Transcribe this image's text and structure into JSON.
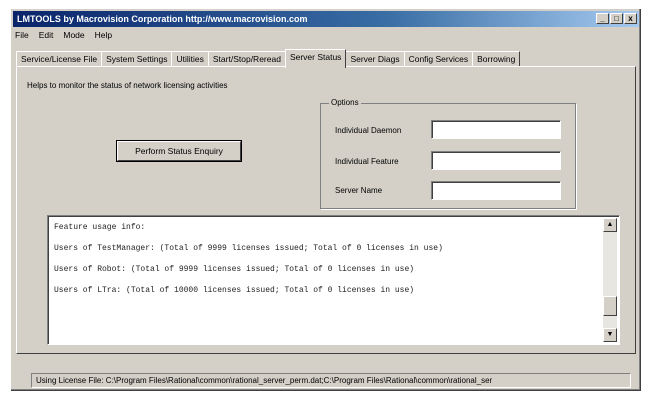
{
  "window": {
    "title": "LMTOOLS by Macrovision Corporation http://www.macrovision.com",
    "controls": {
      "minimize": "_",
      "maximize": "□",
      "close": "x"
    }
  },
  "menu": [
    "File",
    "Edit",
    "Mode",
    "Help"
  ],
  "tabs": [
    {
      "label": "Service/License File"
    },
    {
      "label": "System Settings"
    },
    {
      "label": "Utilities"
    },
    {
      "label": "Start/Stop/Reread"
    },
    {
      "label": "Server Status",
      "active": true
    },
    {
      "label": "Server Diags"
    },
    {
      "label": "Config Services"
    },
    {
      "label": "Borrowing"
    }
  ],
  "server_status": {
    "help_text": "Helps to monitor the status of network licensing activities",
    "perform_button": "Perform Status Enquiry",
    "options": {
      "legend": "Options",
      "daemon_label": "Individual Daemon",
      "daemon_value": "",
      "feature_label": "Individual Feature",
      "feature_value": "",
      "server_label": "Server Name",
      "server_value": ""
    },
    "output": [
      "Feature usage info:",
      "Users of TestManager:  (Total of 9999 licenses issued;  Total of 0 licenses in use)",
      "Users of Robot:  (Total of 9999 licenses issued;  Total of 0 licenses in use)",
      "Users of LTra:  (Total of 10000 licenses issued;  Total of 0 licenses in use)"
    ]
  },
  "statusbar": {
    "text": "Using License File:  C:\\Program Files\\Rational\\common\\rational_server_perm.dat;C:\\Program Files\\Rational\\common\\rational_ser"
  }
}
